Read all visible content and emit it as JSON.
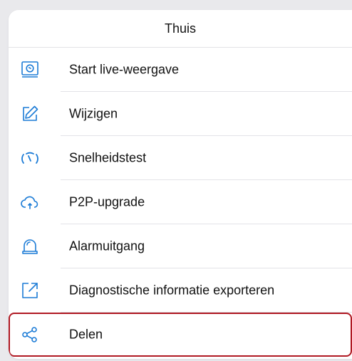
{
  "sheet": {
    "title": "Thuis"
  },
  "menu": {
    "items": [
      {
        "label": "Start live-weergave",
        "icon": "live-view-icon"
      },
      {
        "label": "Wijzigen",
        "icon": "edit-icon"
      },
      {
        "label": "Snelheidstest",
        "icon": "speedometer-icon"
      },
      {
        "label": "P2P-upgrade",
        "icon": "cloud-upload-icon"
      },
      {
        "label": "Alarmuitgang",
        "icon": "alarm-light-icon"
      },
      {
        "label": "Diagnostische informatie exporteren",
        "icon": "export-icon"
      },
      {
        "label": "Delen",
        "icon": "share-icon"
      }
    ]
  },
  "colors": {
    "accent": "#1b7bd6",
    "highlight_border": "#b01923"
  }
}
